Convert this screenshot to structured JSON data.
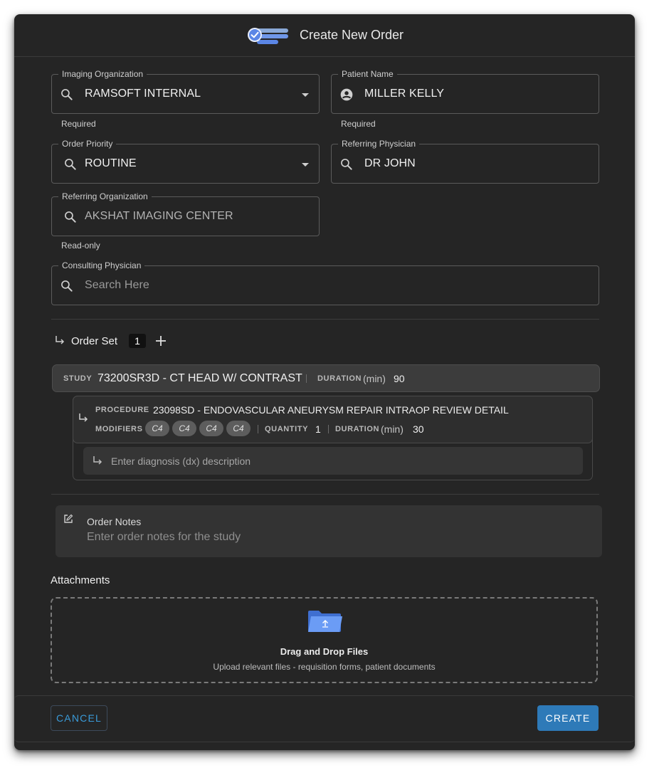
{
  "dialog": {
    "title": "Create New Order",
    "logo_icon": "order-checklist-icon"
  },
  "fields": {
    "imaging_org": {
      "legend": "Imaging Organization",
      "value": "RAMSOFT INTERNAL",
      "helper": "Required",
      "icon": "search-icon"
    },
    "patient_name": {
      "legend": "Patient Name",
      "value": "MILLER KELLY",
      "helper": "Required",
      "icon": "person-avatar-icon"
    },
    "order_priority": {
      "legend": "Order Priority",
      "value": "ROUTINE",
      "icon": "search-icon"
    },
    "referring_physician": {
      "legend": "Referring Physician",
      "value": "DR JOHN",
      "icon": "search-icon"
    },
    "referring_org": {
      "legend": "Referring Organization",
      "value": "AKSHAT IMAGING CENTER",
      "helper": "Read-only",
      "icon": "search-icon"
    },
    "consulting_physician": {
      "legend": "Consulting Physician",
      "placeholder": "Search Here",
      "icon": "search-icon"
    }
  },
  "order_set": {
    "label": "Order Set",
    "count": "1",
    "study": {
      "study_label": "STUDY",
      "study_value": "73200SR3D - CT HEAD W/ CONTRAST",
      "duration_label": "DURATION",
      "duration_unit": "(min)",
      "duration_value": "90"
    },
    "procedure": {
      "procedure_label": "PROCEDURE",
      "procedure_value": "23098SD - ENDOVASCULAR ANEURYSM REPAIR INTRAOP REVIEW DETAIL",
      "modifiers_label": "MODIFIERS",
      "modifiers": [
        "C4",
        "C4",
        "C4",
        "C4"
      ],
      "quantity_label": "QUANTITY",
      "quantity_value": "1",
      "duration_label": "DURATION",
      "duration_unit": "(min)",
      "duration_value": "30"
    },
    "dx_placeholder": "Enter diagnosis (dx) description"
  },
  "notes": {
    "title": "Order Notes",
    "placeholder": "Enter order notes for the study"
  },
  "attachments": {
    "title": "Attachments",
    "drop_title": "Drag and Drop Files",
    "drop_subtitle": "Upload relevant files - requisition forms, patient documents"
  },
  "footer": {
    "cancel_label": "CANCEL",
    "create_label": "CREATE"
  },
  "colors": {
    "dialog_bg": "#252525",
    "accent_blue": "#2e7ab8",
    "link_blue": "#3a9bd9",
    "folder_blue": "#6b9cf5"
  }
}
